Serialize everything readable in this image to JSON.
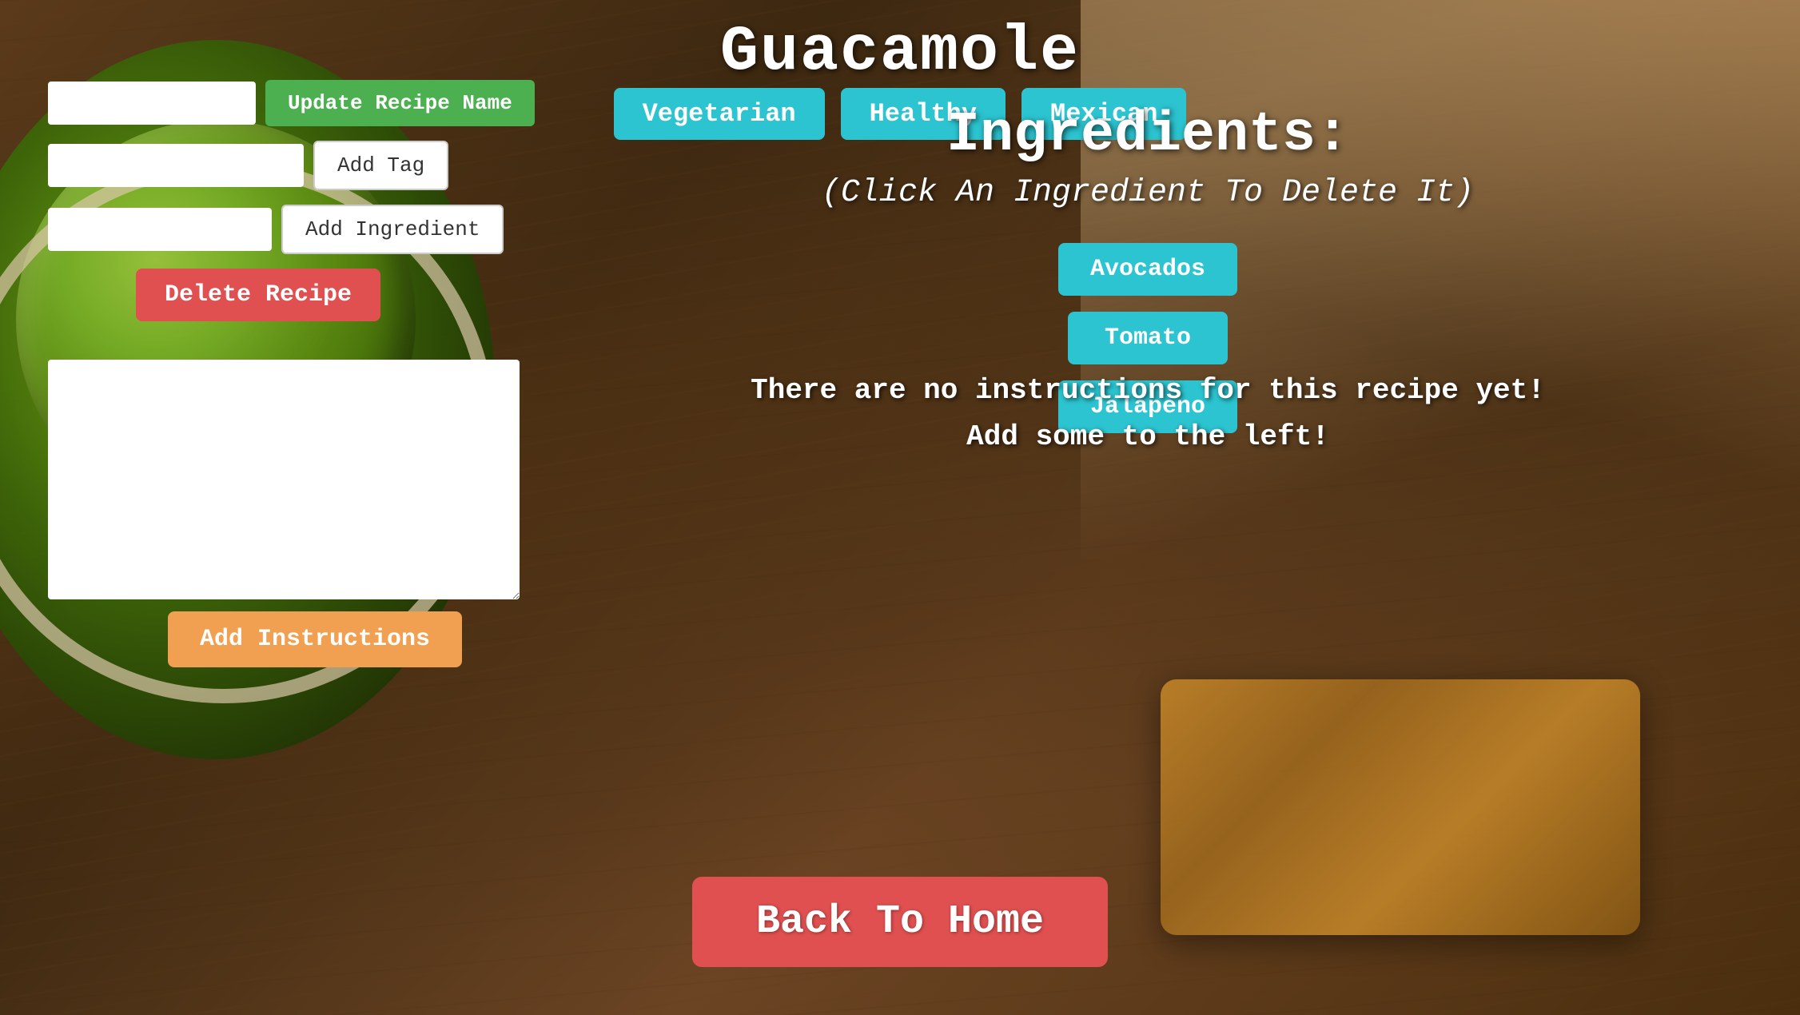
{
  "page": {
    "title": "Guacamole",
    "tags": [
      {
        "id": "vegetarian",
        "label": "Vegetarian"
      },
      {
        "id": "healthy",
        "label": "Healthy"
      },
      {
        "id": "mexican",
        "label": "Mexican"
      }
    ]
  },
  "left_panel": {
    "name_input_placeholder": "",
    "name_input_value": "",
    "update_recipe_name_label": "Update Recipe Name",
    "tag_input_placeholder": "",
    "tag_input_value": "",
    "add_tag_label": "Add Tag",
    "ingredient_input_placeholder": "",
    "ingredient_input_value": "",
    "add_ingredient_label": "Add Ingredient",
    "delete_recipe_label": "Delete Recipe",
    "instructions_placeholder": "",
    "add_instructions_label": "Add Instructions"
  },
  "ingredients_panel": {
    "title": "Ingredients:",
    "subtitle": "(Click An Ingredient To Delete It)",
    "ingredients": [
      {
        "id": "avocados",
        "label": "Avocados"
      },
      {
        "id": "tomato",
        "label": "Tomato"
      },
      {
        "id": "jalapeno",
        "label": "Jalapeno"
      }
    ],
    "no_instructions_text": "There are no instructions for this recipe yet!\nAdd some to the left!"
  },
  "footer": {
    "back_to_home_label": "Back To Home"
  }
}
